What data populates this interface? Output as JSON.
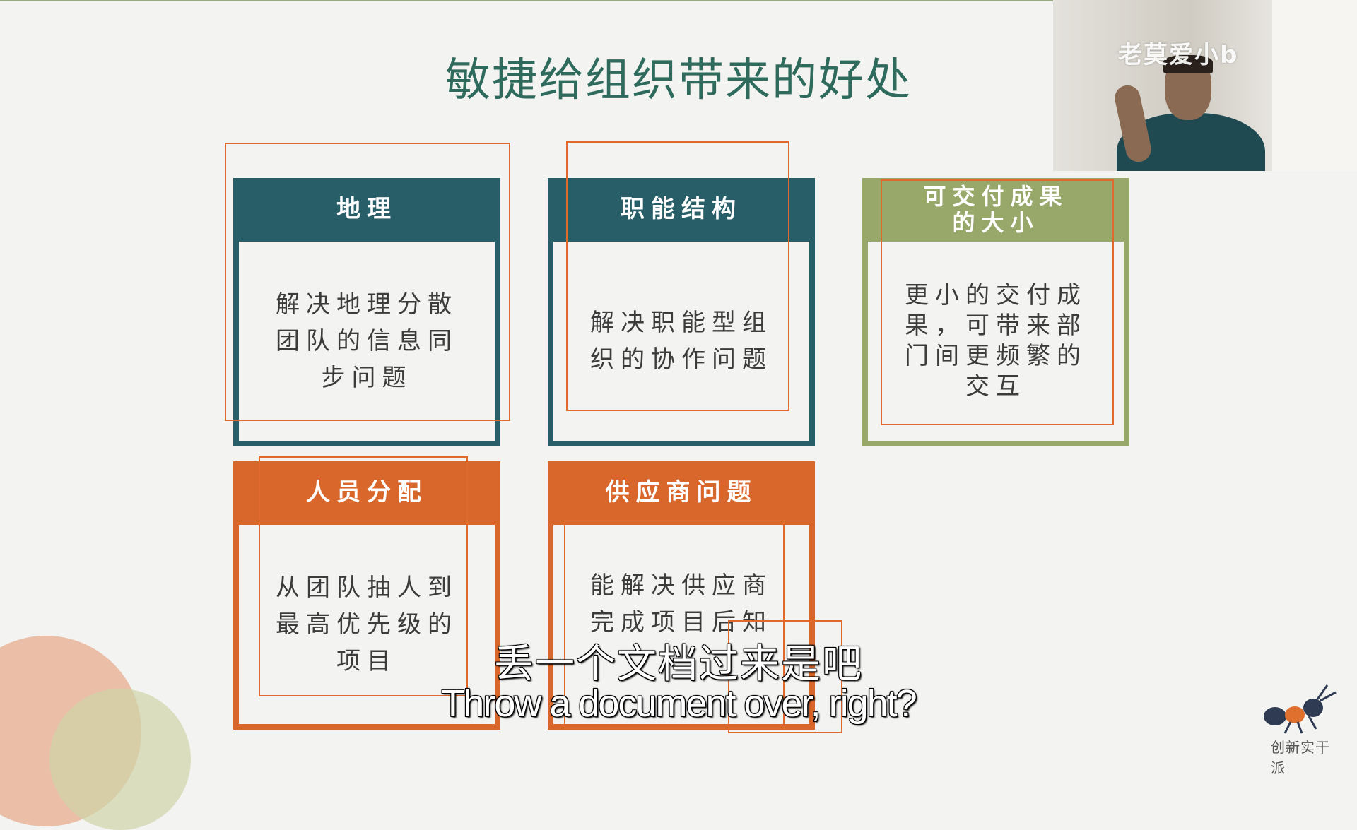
{
  "slide": {
    "title": "敏捷给组织带来的好处",
    "cards": [
      {
        "id": "geography",
        "heading": "地理",
        "body": "解决地理分散\n团队的信息同\n步问题",
        "color": "#275e68"
      },
      {
        "id": "function",
        "heading": "职能结构",
        "body": "解决职能型组\n织的协作问题",
        "color": "#275e68"
      },
      {
        "id": "deliverable",
        "heading": "可交付成果\n的大小",
        "body": "更小的交付成\n果，可带来部\n门间更频繁的\n交互",
        "color": "#98a86a"
      },
      {
        "id": "staffing",
        "heading": "人员分配",
        "body": "从团队抽人到\n最高优先级的\n项目",
        "color": "#d9662b"
      },
      {
        "id": "supplier",
        "heading": "供应商问题",
        "body": "能解决供应商\n完成项目后知",
        "color": "#d9662b"
      }
    ]
  },
  "webcam": {
    "watermark": "老莫爱小b"
  },
  "subtitles": {
    "chinese": "丢一个文档过来是吧",
    "english": "Throw a document over, right?"
  },
  "logo": {
    "text": "创新实干派",
    "icon": "ant-icon"
  },
  "colors": {
    "teal": "#275e68",
    "green": "#98a86a",
    "orange": "#d9662b",
    "outline": "#e06a2e",
    "title": "#2f6b5d"
  }
}
